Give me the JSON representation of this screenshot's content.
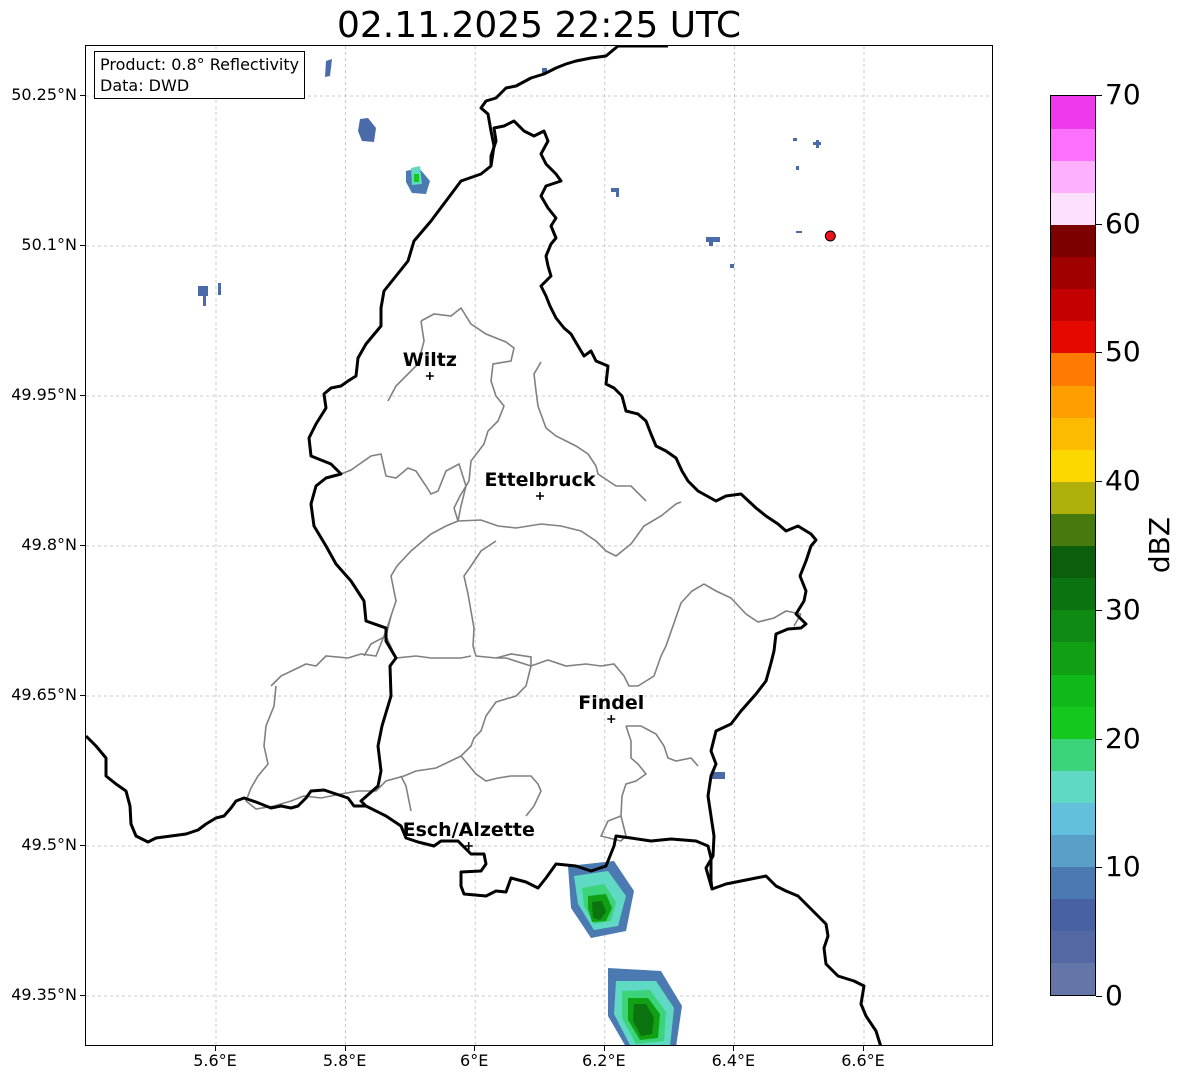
{
  "title": "02.11.2025 22:25 UTC",
  "info": {
    "product": "Product: 0.8° Reflectivity",
    "data": "Data: DWD"
  },
  "axes": {
    "x_ticks": [
      "5.6°E",
      "5.8°E",
      "6°E",
      "6.2°E",
      "6.4°E",
      "6.6°E"
    ],
    "y_ticks": [
      "50.25°N",
      "50.1°N",
      "49.95°N",
      "49.8°N",
      "49.65°N",
      "49.5°N",
      "49.35°N"
    ],
    "lon_range": [
      5.4,
      6.8
    ],
    "lat_range": [
      49.3,
      50.3
    ],
    "gridlines": true
  },
  "cities": [
    {
      "name": "Wiltz",
      "lon": 5.93,
      "lat": 49.97
    },
    {
      "name": "Ettelbruck",
      "lon": 6.1,
      "lat": 49.85
    },
    {
      "name": "Findel",
      "lon": 6.21,
      "lat": 49.627
    },
    {
      "name": "Esch/Alzette",
      "lon": 5.99,
      "lat": 49.5
    }
  ],
  "radar_site": {
    "lon": 6.548,
    "lat": 50.11,
    "color": "#e8141c"
  },
  "colorbar": {
    "label": "dBZ",
    "ticks": [
      "0",
      "10",
      "20",
      "30",
      "40",
      "50",
      "60",
      "70"
    ],
    "colors": [
      "#6476a8",
      "#5468a3",
      "#4761a2",
      "#4a7ab1",
      "#59a0c8",
      "#63c0dc",
      "#5fd8c4",
      "#3cd47a",
      "#14c81e",
      "#10b91a",
      "#119f14",
      "#0f8a12",
      "#0b7410",
      "#0a5e0c",
      "#477a0c",
      "#b0b00a",
      "#fdd700",
      "#fdbb00",
      "#fd9f00",
      "#fd7c00",
      "#e50800",
      "#c40000",
      "#a00000",
      "#7d0000",
      "#fde0fd",
      "#fdb0fd",
      "#fd70fd",
      "#ec3aec"
    ]
  },
  "radar_echoes": [
    {
      "lon": 5.59,
      "lat": 50.05,
      "dbz": 2
    },
    {
      "lon": 5.6,
      "lat": 50.05,
      "dbz": 4
    },
    {
      "lon": 5.78,
      "lat": 50.28,
      "dbz": 3
    },
    {
      "lon": 5.83,
      "lat": 50.22,
      "dbz": 4
    },
    {
      "lon": 5.91,
      "lat": 50.165,
      "dbz": 18
    },
    {
      "lon": 5.92,
      "lat": 50.16,
      "dbz": 22
    },
    {
      "lon": 6.11,
      "lat": 50.278,
      "dbz": 3
    },
    {
      "lon": 6.21,
      "lat": 50.155,
      "dbz": 3
    },
    {
      "lon": 6.37,
      "lat": 50.108,
      "dbz": 4
    },
    {
      "lon": 6.4,
      "lat": 50.08,
      "dbz": 2
    },
    {
      "lon": 6.5,
      "lat": 50.205,
      "dbz": 2
    },
    {
      "lon": 6.53,
      "lat": 50.203,
      "dbz": 3
    },
    {
      "lon": 6.5,
      "lat": 50.178,
      "dbz": 2
    },
    {
      "lon": 6.38,
      "lat": 49.572,
      "dbz": 3
    },
    {
      "lon": 6.2,
      "lat": 49.46,
      "dbz": 16
    },
    {
      "lon": 6.2,
      "lat": 49.44,
      "dbz": 26
    },
    {
      "lon": 6.27,
      "lat": 49.34,
      "dbz": 14
    },
    {
      "lon": 6.26,
      "lat": 49.33,
      "dbz": 28
    }
  ]
}
